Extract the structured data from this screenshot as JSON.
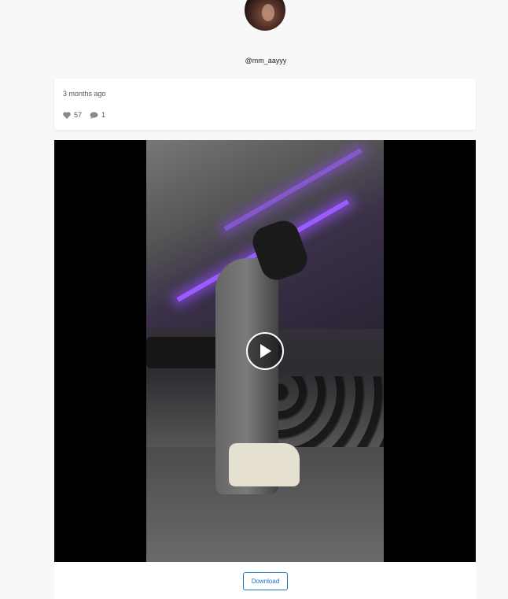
{
  "profile": {
    "username": "@mm_aayyy"
  },
  "post": {
    "time_ago": "3 months ago",
    "likes": "57",
    "comments": "1",
    "like_icon": "heart-icon",
    "comment_icon": "comment-icon"
  },
  "media": {
    "play_icon": "play-icon",
    "download_label": "Download"
  },
  "colors": {
    "accent": "#1a73c8",
    "background": "#f8f8f8"
  }
}
